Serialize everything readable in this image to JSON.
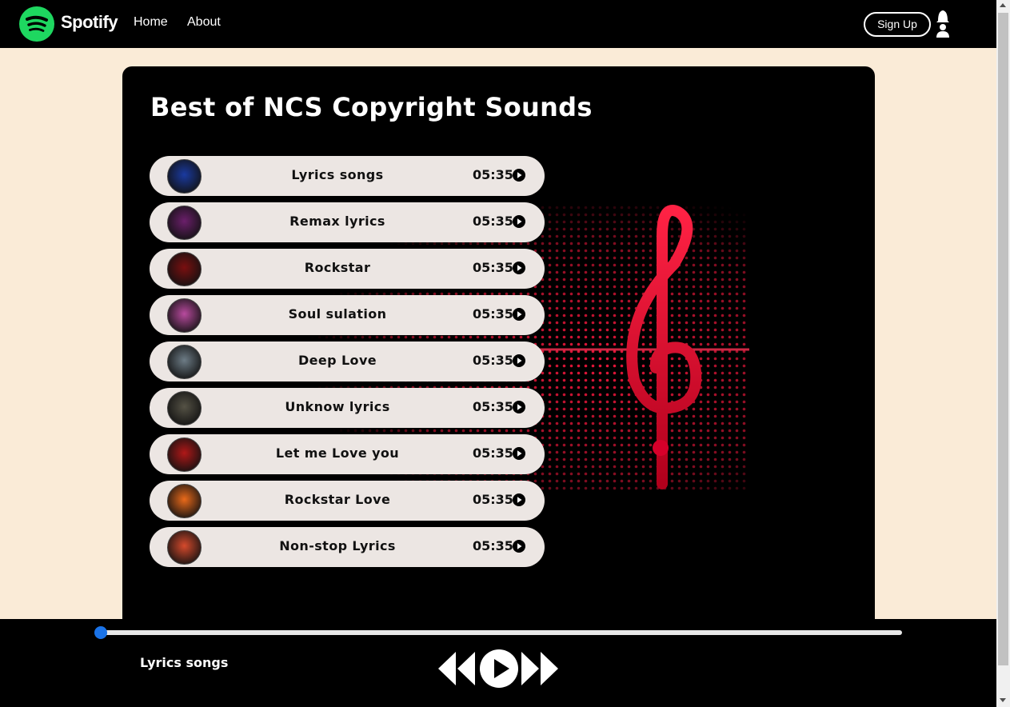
{
  "nav": {
    "brand": "Spotify",
    "links": [
      "Home",
      "About"
    ],
    "signup": "Sign Up",
    "icons": [
      "spotify-logo-icon",
      "user-icon"
    ]
  },
  "main": {
    "title": "Best of NCS Copyright Sounds",
    "songs": [
      {
        "title": "Lyrics songs",
        "duration": "05:35",
        "cover": "#1a3aa0"
      },
      {
        "title": "Remax lyrics",
        "duration": "05:35",
        "cover": "#6b1f6b"
      },
      {
        "title": "Rockstar",
        "duration": "05:35",
        "cover": "#7a0f10"
      },
      {
        "title": "Soul sulation",
        "duration": "05:35",
        "cover": "#b84a9e"
      },
      {
        "title": "Deep Love",
        "duration": "05:35",
        "cover": "#6d7c86"
      },
      {
        "title": "Unknow lyrics",
        "duration": "05:35",
        "cover": "#555245"
      },
      {
        "title": "Let me Love you",
        "duration": "05:35",
        "cover": "#b01818"
      },
      {
        "title": "Rockstar Love",
        "duration": "05:35",
        "cover": "#ea6a1a"
      },
      {
        "title": "Non-stop Lyrics",
        "duration": "05:35",
        "cover": "#d64a2c"
      }
    ]
  },
  "player": {
    "current_song": "Lyrics songs",
    "progress": 0,
    "controls": [
      "previous-icon",
      "play-icon",
      "next-icon"
    ]
  },
  "colors": {
    "brand_green": "#1ed760",
    "page_bg": "#faebd7",
    "row_bg": "#ece6e3",
    "progress_knob": "#1a73e8",
    "accent_red": "#e8163a"
  }
}
